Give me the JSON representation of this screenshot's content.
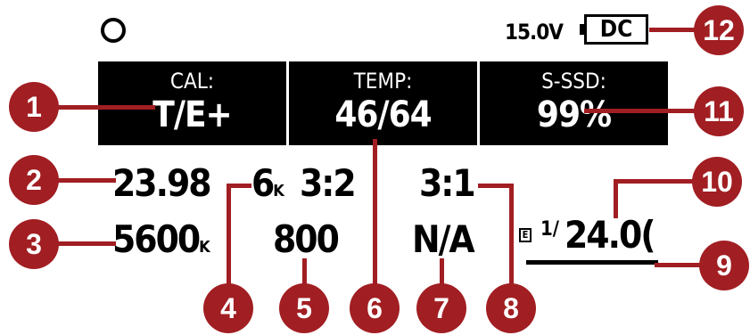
{
  "status": {
    "voltage": "15.0V",
    "power_source": "DC"
  },
  "panels": [
    {
      "label": "CAL:",
      "value": "T/E+"
    },
    {
      "label": "TEMP:",
      "value": "46/64"
    },
    {
      "label": "S-SSD:",
      "value": "99%"
    }
  ],
  "row1": {
    "fps": "23.98",
    "resolution": "6",
    "resolution_unit": "K",
    "aspect": "3:2",
    "ratio": "3:1"
  },
  "row2": {
    "white_balance": "5600",
    "wb_unit": "K",
    "iso": "800",
    "nd": "N/A",
    "shutter_prefix": "E",
    "shutter_fraction": "1/",
    "shutter_value": "24.0("
  },
  "callouts": [
    "1",
    "2",
    "3",
    "4",
    "5",
    "6",
    "7",
    "8",
    "9",
    "10",
    "11",
    "12"
  ],
  "colors": {
    "callout": "#a11e22",
    "background": "#ffffff",
    "panel": "#000000"
  }
}
